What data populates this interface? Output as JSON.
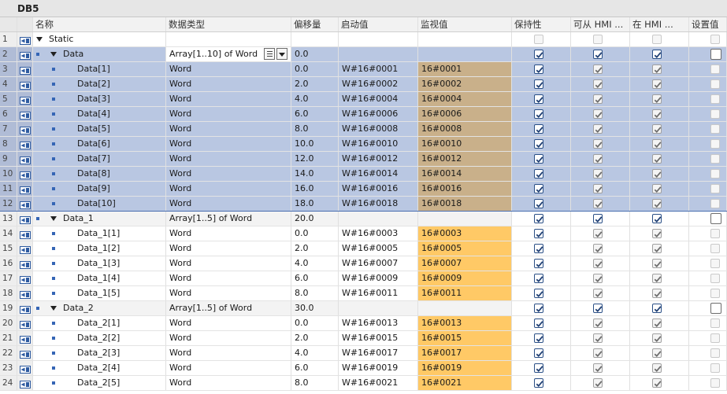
{
  "window": {
    "title": "DB5"
  },
  "columns": {
    "name": "名称",
    "datatype": "数据类型",
    "offset": "偏移量",
    "start_value": "启动值",
    "monitor_value": "监视值",
    "retain": "保持性",
    "hmi_accessible": "可从 HMI ...",
    "hmi_visible": "在 HMI ...",
    "setpoint": "设置值"
  },
  "colors": {
    "selection": "#b9c7e2",
    "monitor_selected": "#c9b08a",
    "monitor_value": "#ffc966",
    "checkbox_check_active": "#1f3f73"
  },
  "rows": [
    {
      "num": "1",
      "level": 0,
      "expand": true,
      "bullet": false,
      "name": "Static",
      "type": "",
      "offset": "",
      "start": "",
      "monitor": "",
      "retain": "dim",
      "hmi1": "dim",
      "hmi2": "dim",
      "set": "dim",
      "style": ""
    },
    {
      "num": "2",
      "level": 1,
      "expand": true,
      "bullet": true,
      "name": "Data",
      "type": "Array[1..10] of Word",
      "offset": "0.0",
      "start": "",
      "monitor": "",
      "retain": "blue",
      "hmi1": "blue",
      "hmi2": "blue",
      "set": "big",
      "style": "sel-head",
      "dropdown": true
    },
    {
      "num": "3",
      "level": 2,
      "expand": false,
      "bullet": true,
      "name": "Data[1]",
      "type": "Word",
      "offset": "0.0",
      "start": "W#16#0001",
      "monitor": "16#0001",
      "retain": "blue",
      "hmi1": "gray",
      "hmi2": "gray",
      "set": "dim",
      "style": "sel"
    },
    {
      "num": "4",
      "level": 2,
      "expand": false,
      "bullet": true,
      "name": "Data[2]",
      "type": "Word",
      "offset": "2.0",
      "start": "W#16#0002",
      "monitor": "16#0002",
      "retain": "blue",
      "hmi1": "gray",
      "hmi2": "gray",
      "set": "dim",
      "style": "sel"
    },
    {
      "num": "5",
      "level": 2,
      "expand": false,
      "bullet": true,
      "name": "Data[3]",
      "type": "Word",
      "offset": "4.0",
      "start": "W#16#0004",
      "monitor": "16#0004",
      "retain": "blue",
      "hmi1": "gray",
      "hmi2": "gray",
      "set": "dim",
      "style": "sel"
    },
    {
      "num": "6",
      "level": 2,
      "expand": false,
      "bullet": true,
      "name": "Data[4]",
      "type": "Word",
      "offset": "6.0",
      "start": "W#16#0006",
      "monitor": "16#0006",
      "retain": "blue",
      "hmi1": "gray",
      "hmi2": "gray",
      "set": "dim",
      "style": "sel"
    },
    {
      "num": "7",
      "level": 2,
      "expand": false,
      "bullet": true,
      "name": "Data[5]",
      "type": "Word",
      "offset": "8.0",
      "start": "W#16#0008",
      "monitor": "16#0008",
      "retain": "blue",
      "hmi1": "gray",
      "hmi2": "gray",
      "set": "dim",
      "style": "sel"
    },
    {
      "num": "8",
      "level": 2,
      "expand": false,
      "bullet": true,
      "name": "Data[6]",
      "type": "Word",
      "offset": "10.0",
      "start": "W#16#0010",
      "monitor": "16#0010",
      "retain": "blue",
      "hmi1": "gray",
      "hmi2": "gray",
      "set": "dim",
      "style": "sel"
    },
    {
      "num": "9",
      "level": 2,
      "expand": false,
      "bullet": true,
      "name": "Data[7]",
      "type": "Word",
      "offset": "12.0",
      "start": "W#16#0012",
      "monitor": "16#0012",
      "retain": "blue",
      "hmi1": "gray",
      "hmi2": "gray",
      "set": "dim",
      "style": "sel"
    },
    {
      "num": "10",
      "level": 2,
      "expand": false,
      "bullet": true,
      "name": "Data[8]",
      "type": "Word",
      "offset": "14.0",
      "start": "W#16#0014",
      "monitor": "16#0014",
      "retain": "blue",
      "hmi1": "gray",
      "hmi2": "gray",
      "set": "dim",
      "style": "sel"
    },
    {
      "num": "11",
      "level": 2,
      "expand": false,
      "bullet": true,
      "name": "Data[9]",
      "type": "Word",
      "offset": "16.0",
      "start": "W#16#0016",
      "monitor": "16#0016",
      "retain": "blue",
      "hmi1": "gray",
      "hmi2": "gray",
      "set": "dim",
      "style": "sel"
    },
    {
      "num": "12",
      "level": 2,
      "expand": false,
      "bullet": true,
      "name": "Data[10]",
      "type": "Word",
      "offset": "18.0",
      "start": "W#16#0018",
      "monitor": "16#0018",
      "retain": "blue",
      "hmi1": "gray",
      "hmi2": "gray",
      "set": "dim",
      "style": "sel active-bottom"
    },
    {
      "num": "13",
      "level": 1,
      "expand": true,
      "bullet": true,
      "name": "Data_1",
      "type": "Array[1..5] of Word",
      "offset": "20.0",
      "start": "",
      "monitor": "",
      "retain": "blue",
      "hmi1": "blue",
      "hmi2": "blue",
      "set": "big",
      "style": "group"
    },
    {
      "num": "14",
      "level": 2,
      "expand": false,
      "bullet": true,
      "name": "Data_1[1]",
      "type": "Word",
      "offset": "0.0",
      "start": "W#16#0003",
      "monitor": "16#0003",
      "retain": "blue",
      "hmi1": "gray",
      "hmi2": "gray",
      "set": "dim",
      "style": ""
    },
    {
      "num": "15",
      "level": 2,
      "expand": false,
      "bullet": true,
      "name": "Data_1[2]",
      "type": "Word",
      "offset": "2.0",
      "start": "W#16#0005",
      "monitor": "16#0005",
      "retain": "blue",
      "hmi1": "gray",
      "hmi2": "gray",
      "set": "dim",
      "style": ""
    },
    {
      "num": "16",
      "level": 2,
      "expand": false,
      "bullet": true,
      "name": "Data_1[3]",
      "type": "Word",
      "offset": "4.0",
      "start": "W#16#0007",
      "monitor": "16#0007",
      "retain": "blue",
      "hmi1": "gray",
      "hmi2": "gray",
      "set": "dim",
      "style": ""
    },
    {
      "num": "17",
      "level": 2,
      "expand": false,
      "bullet": true,
      "name": "Data_1[4]",
      "type": "Word",
      "offset": "6.0",
      "start": "W#16#0009",
      "monitor": "16#0009",
      "retain": "blue",
      "hmi1": "gray",
      "hmi2": "gray",
      "set": "dim",
      "style": ""
    },
    {
      "num": "18",
      "level": 2,
      "expand": false,
      "bullet": true,
      "name": "Data_1[5]",
      "type": "Word",
      "offset": "8.0",
      "start": "W#16#0011",
      "monitor": "16#0011",
      "retain": "blue",
      "hmi1": "gray",
      "hmi2": "gray",
      "set": "dim",
      "style": ""
    },
    {
      "num": "19",
      "level": 1,
      "expand": true,
      "bullet": true,
      "name": "Data_2",
      "type": "Array[1..5] of Word",
      "offset": "30.0",
      "start": "",
      "monitor": "",
      "retain": "blue",
      "hmi1": "blue",
      "hmi2": "blue",
      "set": "big",
      "style": "group"
    },
    {
      "num": "20",
      "level": 2,
      "expand": false,
      "bullet": true,
      "name": "Data_2[1]",
      "type": "Word",
      "offset": "0.0",
      "start": "W#16#0013",
      "monitor": "16#0013",
      "retain": "blue",
      "hmi1": "gray",
      "hmi2": "gray",
      "set": "dim",
      "style": ""
    },
    {
      "num": "21",
      "level": 2,
      "expand": false,
      "bullet": true,
      "name": "Data_2[2]",
      "type": "Word",
      "offset": "2.0",
      "start": "W#16#0015",
      "monitor": "16#0015",
      "retain": "blue",
      "hmi1": "gray",
      "hmi2": "gray",
      "set": "dim",
      "style": ""
    },
    {
      "num": "22",
      "level": 2,
      "expand": false,
      "bullet": true,
      "name": "Data_2[3]",
      "type": "Word",
      "offset": "4.0",
      "start": "W#16#0017",
      "monitor": "16#0017",
      "retain": "blue",
      "hmi1": "gray",
      "hmi2": "gray",
      "set": "dim",
      "style": ""
    },
    {
      "num": "23",
      "level": 2,
      "expand": false,
      "bullet": true,
      "name": "Data_2[4]",
      "type": "Word",
      "offset": "6.0",
      "start": "W#16#0019",
      "monitor": "16#0019",
      "retain": "blue",
      "hmi1": "gray",
      "hmi2": "gray",
      "set": "dim",
      "style": ""
    },
    {
      "num": "24",
      "level": 2,
      "expand": false,
      "bullet": true,
      "name": "Data_2[5]",
      "type": "Word",
      "offset": "8.0",
      "start": "W#16#0021",
      "monitor": "16#0021",
      "retain": "blue",
      "hmi1": "gray",
      "hmi2": "gray",
      "set": "dim",
      "style": ""
    }
  ]
}
